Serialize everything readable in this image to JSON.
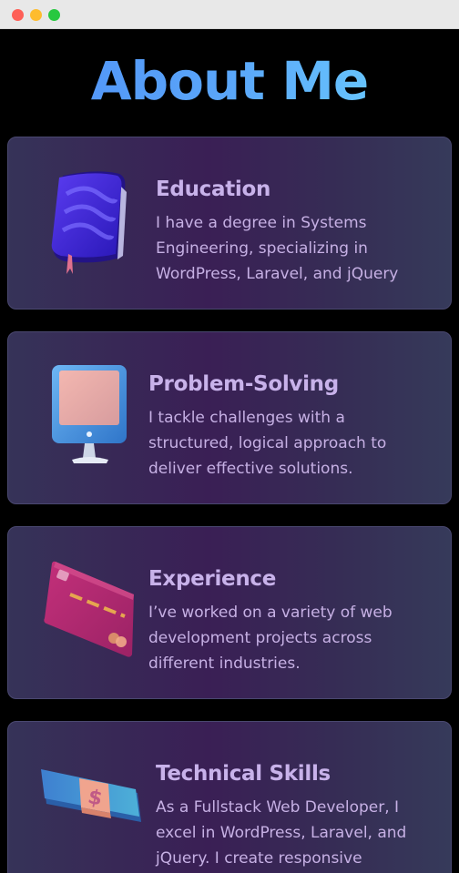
{
  "window": {
    "controls": [
      "close",
      "minimize",
      "zoom"
    ]
  },
  "page": {
    "title": "About Me"
  },
  "cards": [
    {
      "title": "Education",
      "description": "I have a degree in Systems Engineering, specializing in WordPress, Laravel, and jQuery",
      "icon": "book-icon"
    },
    {
      "title": "Problem-Solving",
      "description": "I tackle challenges with a structured, logical approach to deliver effective solutions.",
      "icon": "monitor-icon"
    },
    {
      "title": "Experience",
      "description": "I’ve worked on a variety of web development projects across different industries.",
      "icon": "credit-card-icon"
    },
    {
      "title": "Technical Skills",
      "description": "As a Fullstack Web Developer, I excel in WordPress, Laravel, and jQuery. I create responsive",
      "icon": "money-icon"
    }
  ],
  "colors": {
    "background": "#000000",
    "heading_gradient_start": "#4f8ff7",
    "heading_gradient_end": "#6fd6ff",
    "card_text": "#c6b0e4"
  }
}
